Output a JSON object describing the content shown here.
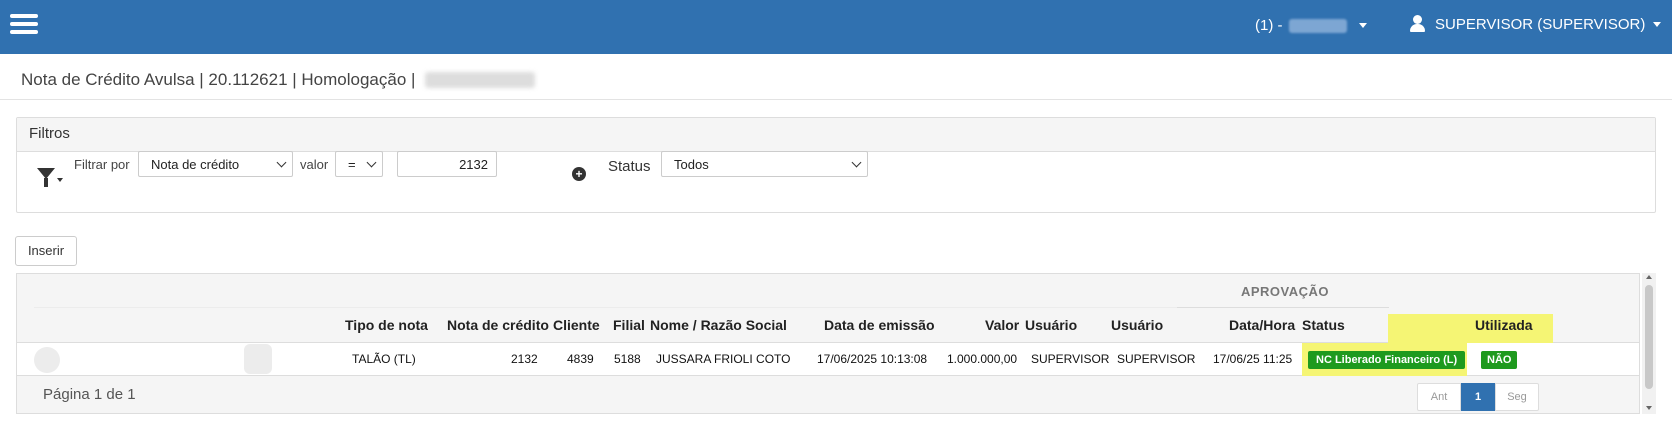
{
  "topbar": {
    "company_prefix": "(1) -",
    "user_label": "SUPERVISOR (SUPERVISOR)"
  },
  "page": {
    "breadcrumb": "Nota de Crédito Avulsa | 20.112621 | Homologação |"
  },
  "filters": {
    "title": "Filtros",
    "filter_by_label": "Filtrar por",
    "filter_by_value": "Nota de crédito",
    "value_label": "valor",
    "operator_value": "=",
    "value_input": "2132",
    "status_label": "Status",
    "status_value": "Todos"
  },
  "actions": {
    "insert_label": "Inserir"
  },
  "grid": {
    "group_header": "APROVAÇÃO",
    "columns": {
      "tipo": "Tipo de nota",
      "nota": "Nota de crédito",
      "cliente": "Cliente",
      "filial": "Filial",
      "nome": "Nome / Razão Social",
      "data_emissao": "Data de emissão",
      "valor": "Valor",
      "usuario": "Usuário",
      "aprov_usuario": "Usuário",
      "aprov_data": "Data/Hora",
      "status": "Status",
      "utilizada": "Utilizada"
    },
    "rows": [
      {
        "tipo": "TALÃO (TL)",
        "nota": "2132",
        "cliente": "4839",
        "filial": "5188",
        "nome": "JUSSARA FRIOLI COTO",
        "data_emissao": "17/06/2025 10:13:08",
        "valor": "1.000.000,00",
        "usuario": "SUPERVISOR",
        "aprov_usuario": "SUPERVISOR",
        "aprov_data": "17/06/25 11:25",
        "status": "NC Liberado Financeiro (L)",
        "utilizada": "NÃO"
      }
    ],
    "pagination": {
      "info": "Página 1 de 1",
      "prev": "Ant",
      "current": "1",
      "next": "Seg"
    }
  },
  "colors": {
    "topbar": "#3071b0",
    "status_badge": "#1e9a1e",
    "status_highlight": "#f5f574"
  }
}
